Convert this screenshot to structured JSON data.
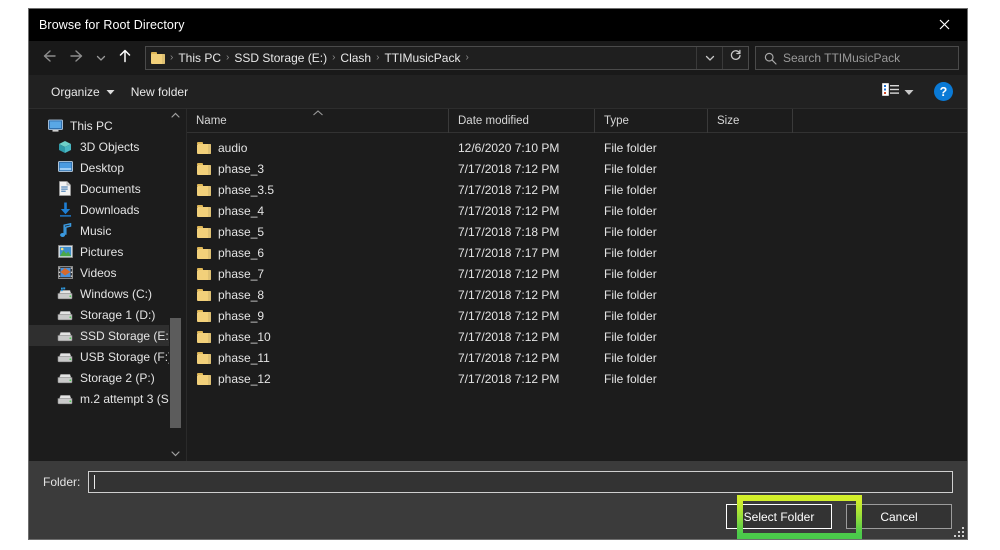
{
  "window": {
    "title": "Browse for Root Directory",
    "close_icon": "close-icon"
  },
  "nav": {
    "back_icon": "arrow-left-icon",
    "forward_icon": "arrow-right-icon",
    "recent_icon": "chevron-down-icon",
    "up_icon": "arrow-up-icon",
    "address_folder_icon": "folder-icon",
    "breadcrumbs": [
      "This PC",
      "SSD Storage (E:)",
      "Clash",
      "TTIMusicPack"
    ],
    "separator": "›",
    "history_dropdown_icon": "chevron-down-icon",
    "refresh_icon": "refresh-icon"
  },
  "search": {
    "icon": "search-icon",
    "placeholder": "Search TTIMusicPack",
    "value": ""
  },
  "commandbar": {
    "organize_label": "Organize",
    "organize_caret_icon": "chevron-down-icon",
    "new_folder_label": "New folder",
    "view_layout_icon": "view-layout-icon",
    "view_caret_icon": "chevron-down-icon",
    "help_label": "?",
    "help_icon": "help-icon"
  },
  "sidebar": {
    "scroll_up_icon": "chevron-up-icon",
    "scroll_down_icon": "chevron-down-icon",
    "items": [
      {
        "label": "This PC",
        "icon": "monitor-icon",
        "indent": false,
        "selected": false
      },
      {
        "label": "3D Objects",
        "icon": "cube-icon",
        "indent": true,
        "selected": false
      },
      {
        "label": "Desktop",
        "icon": "desktop-icon",
        "indent": true,
        "selected": false
      },
      {
        "label": "Documents",
        "icon": "document-icon",
        "indent": true,
        "selected": false
      },
      {
        "label": "Downloads",
        "icon": "download-icon",
        "indent": true,
        "selected": false
      },
      {
        "label": "Music",
        "icon": "music-icon",
        "indent": true,
        "selected": false
      },
      {
        "label": "Pictures",
        "icon": "pictures-icon",
        "indent": true,
        "selected": false
      },
      {
        "label": "Videos",
        "icon": "videos-icon",
        "indent": true,
        "selected": false
      },
      {
        "label": "Windows (C:)",
        "icon": "os-drive-icon",
        "indent": true,
        "selected": false
      },
      {
        "label": "Storage 1 (D:)",
        "icon": "drive-icon",
        "indent": true,
        "selected": false
      },
      {
        "label": "SSD Storage (E:)",
        "icon": "drive-icon",
        "indent": true,
        "selected": true
      },
      {
        "label": "USB Storage (F:)",
        "icon": "drive-icon",
        "indent": true,
        "selected": false
      },
      {
        "label": "Storage 2 (P:)",
        "icon": "drive-icon",
        "indent": true,
        "selected": false
      },
      {
        "label": "m.2 attempt 3 (S",
        "icon": "drive-icon",
        "indent": true,
        "selected": false
      }
    ]
  },
  "filelist": {
    "columns": [
      {
        "key": "name",
        "label": "Name",
        "sorted": "asc"
      },
      {
        "key": "date",
        "label": "Date modified",
        "sorted": ""
      },
      {
        "key": "type",
        "label": "Type",
        "sorted": ""
      },
      {
        "key": "size",
        "label": "Size",
        "sorted": ""
      }
    ],
    "sort_caret_icon": "caret-up-icon",
    "rows": [
      {
        "icon": "folder-icon",
        "name": "audio",
        "date": "12/6/2020 7:10 PM",
        "type": "File folder",
        "size": ""
      },
      {
        "icon": "folder-icon",
        "name": "phase_3",
        "date": "7/17/2018 7:12 PM",
        "type": "File folder",
        "size": ""
      },
      {
        "icon": "folder-icon",
        "name": "phase_3.5",
        "date": "7/17/2018 7:12 PM",
        "type": "File folder",
        "size": ""
      },
      {
        "icon": "folder-icon",
        "name": "phase_4",
        "date": "7/17/2018 7:12 PM",
        "type": "File folder",
        "size": ""
      },
      {
        "icon": "folder-icon",
        "name": "phase_5",
        "date": "7/17/2018 7:18 PM",
        "type": "File folder",
        "size": ""
      },
      {
        "icon": "folder-icon",
        "name": "phase_6",
        "date": "7/17/2018 7:17 PM",
        "type": "File folder",
        "size": ""
      },
      {
        "icon": "folder-icon",
        "name": "phase_7",
        "date": "7/17/2018 7:12 PM",
        "type": "File folder",
        "size": ""
      },
      {
        "icon": "folder-icon",
        "name": "phase_8",
        "date": "7/17/2018 7:12 PM",
        "type": "File folder",
        "size": ""
      },
      {
        "icon": "folder-icon",
        "name": "phase_9",
        "date": "7/17/2018 7:12 PM",
        "type": "File folder",
        "size": ""
      },
      {
        "icon": "folder-icon",
        "name": "phase_10",
        "date": "7/17/2018 7:12 PM",
        "type": "File folder",
        "size": ""
      },
      {
        "icon": "folder-icon",
        "name": "phase_11",
        "date": "7/17/2018 7:12 PM",
        "type": "File folder",
        "size": ""
      },
      {
        "icon": "folder-icon",
        "name": "phase_12",
        "date": "7/17/2018 7:12 PM",
        "type": "File folder",
        "size": ""
      }
    ]
  },
  "footer": {
    "folder_label": "Folder:",
    "folder_value": "",
    "select_button": "Select Folder",
    "cancel_button": "Cancel",
    "resize_grip_icon": "resize-grip-icon"
  },
  "annotation": {
    "highlight_target": "Select Folder",
    "highlight_color_top": "#d4ef2a",
    "highlight_color_bottom": "#49c94b"
  }
}
